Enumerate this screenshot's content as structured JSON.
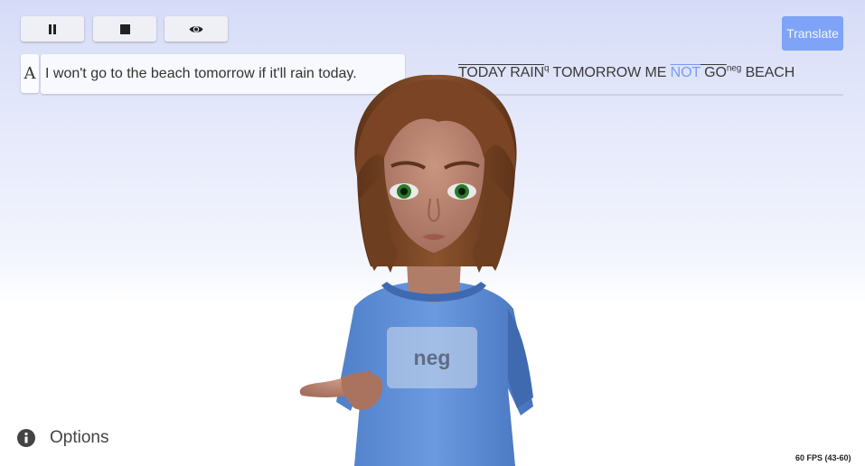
{
  "toolbar": {
    "pause_icon": "pause-icon",
    "stop_icon": "stop-icon",
    "eye_icon": "eye-icon",
    "translate_label": "Translate"
  },
  "input": {
    "font_button_label": "A",
    "value": "I won't go to the beach tomorrow if it'll rain today."
  },
  "gloss": {
    "part1": "TODAY RAIN",
    "sup1": "q",
    "part2": " TOMORROW ME ",
    "highlight": "NOT",
    "part3": " GO",
    "sup2": "neg",
    "part4": " BEACH",
    "highlight_color": "#7b9cf2"
  },
  "avatar": {
    "sign_label": "neg"
  },
  "footer": {
    "options_label": "Options",
    "options_icon": "info-icon",
    "fps": "60 FPS (43-60)"
  },
  "colors": {
    "accent": "#7ea3f7",
    "shirt": "#5f8fd6",
    "hair": "#7a4425"
  }
}
